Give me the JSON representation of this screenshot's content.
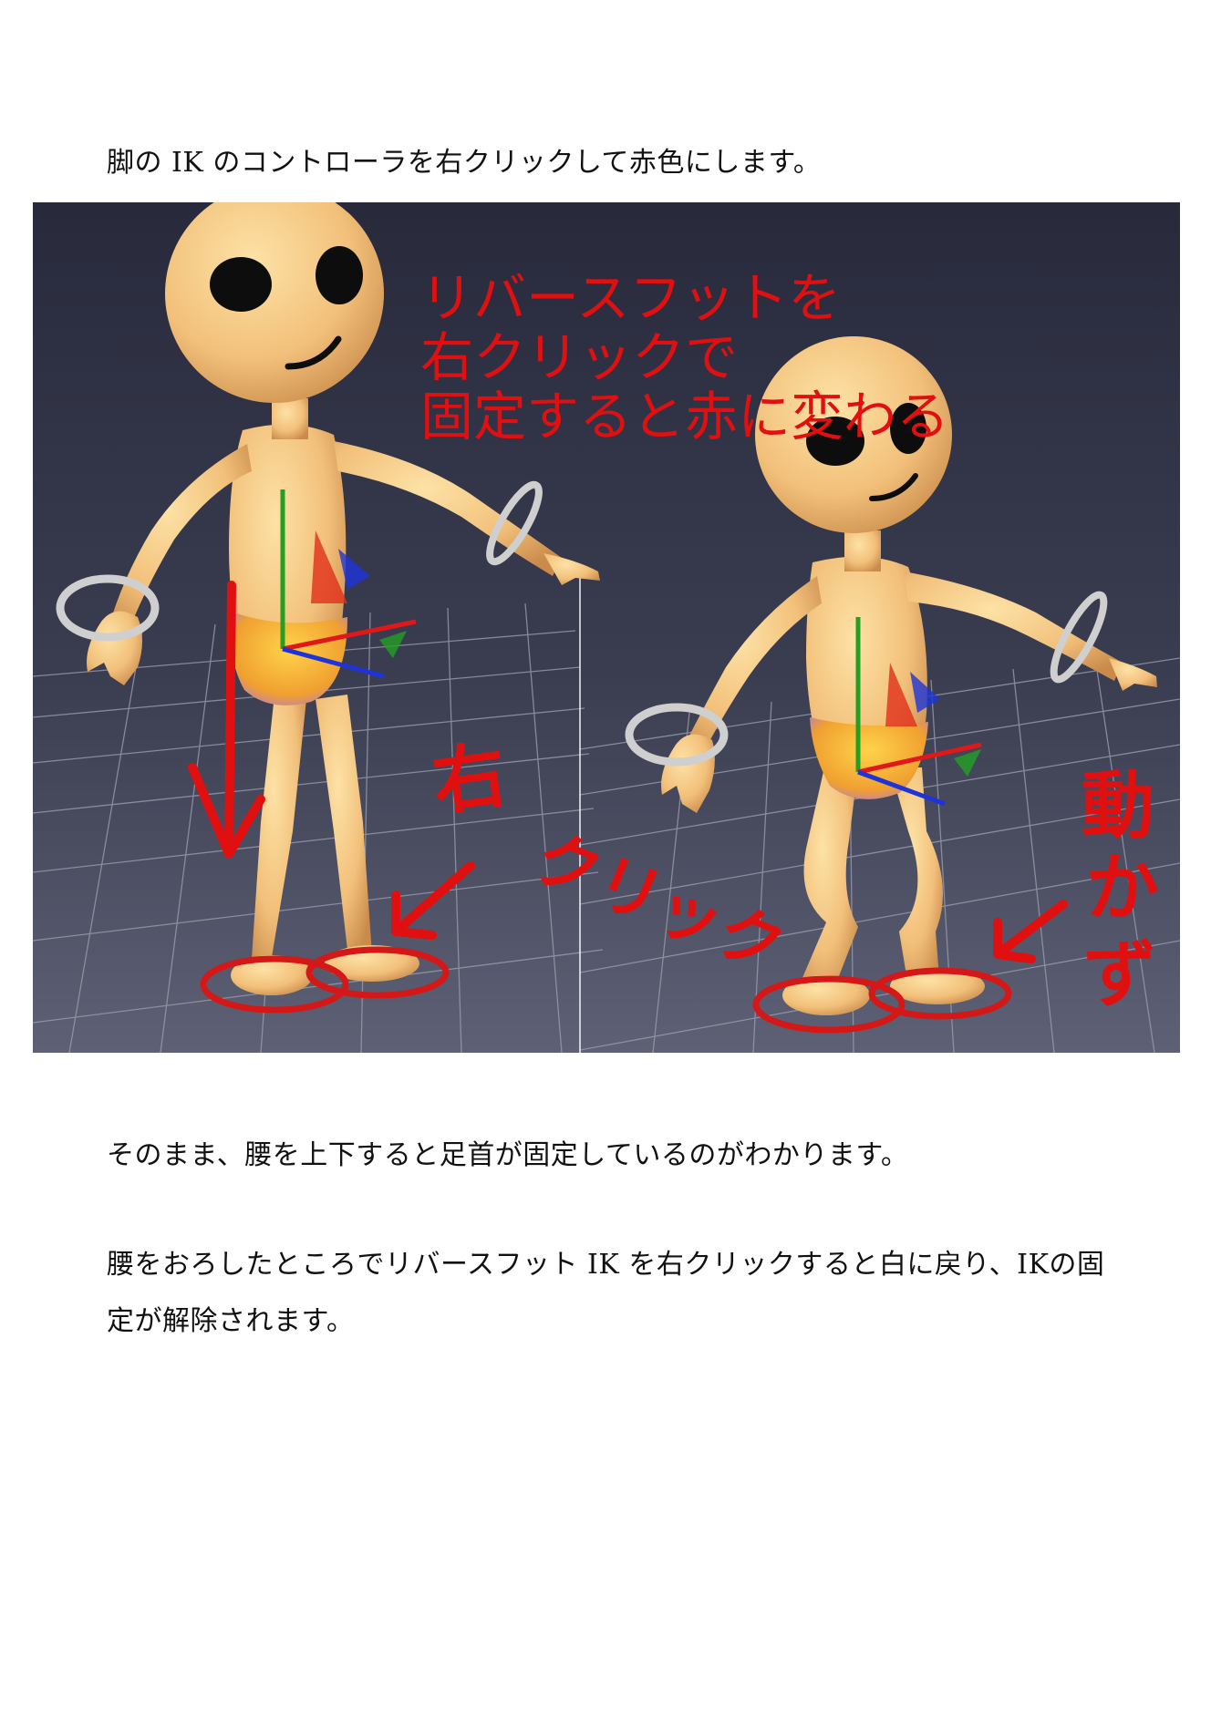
{
  "paragraphs": {
    "intro": "脚の IK のコントローラを右クリックして赤色にします。",
    "hip_move": "そのまま、腰を上下すると足首が固定しているのがわかります。",
    "release": "腰をおろしたところでリバースフット IK を右クリックすると白に戻り、IKの固定が解除されます。"
  },
  "figure": {
    "annotation_lines": [
      "リバースフットを",
      "右クリックで",
      "固定すると赤に変わる"
    ],
    "handwritten_right_click": [
      "右",
      "クリック"
    ],
    "handwritten_not_move": [
      "動",
      "か",
      "ず"
    ],
    "colors": {
      "viewport_bg_top": "#2a2c3e",
      "viewport_bg_bottom": "#5c5f73",
      "annotation_red": "#e01010",
      "skin": "#f0c27a",
      "ik_ring_red": "#d41818",
      "ik_ring_white": "#cfcfcf"
    }
  }
}
